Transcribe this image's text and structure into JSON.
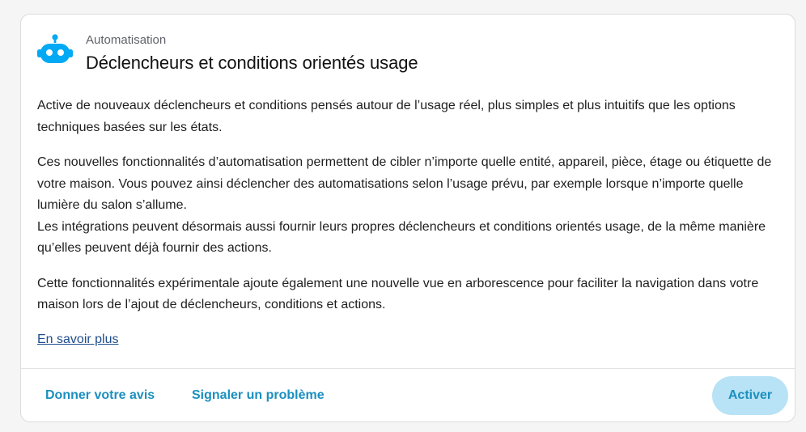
{
  "header": {
    "subtitle": "Automatisation",
    "title": "Déclencheurs et conditions orientés usage",
    "icon": "robot-icon"
  },
  "content": {
    "paragraph1": "Active de nouveaux déclencheurs et conditions pensés autour de l’usage réel, plus simples et plus intuitifs que les options techniques basées sur les états.",
    "paragraph2": "Ces nouvelles fonctionnalités d’automatisation permettent de cibler n’importe quelle entité, appareil, pièce, étage ou étiquette de votre maison. Vous pouvez ainsi déclencher des automatisations selon l’usage prévu, par exemple lorsque n’importe quelle lumière du salon s’allume.",
    "paragraph3": "Les intégrations peuvent désormais aussi fournir leurs propres déclencheurs et conditions orientés usage, de la même manière qu’elles peuvent déjà fournir des actions.",
    "paragraph4": "Cette fonctionnalités expérimentale ajoute également une nouvelle vue en arborescence pour faciliter la navigation dans votre maison lors de l’ajout de déclencheurs, conditions et actions.",
    "learn_more": "En savoir plus"
  },
  "actions": {
    "feedback_label": "Donner votre avis",
    "report_label": "Signaler un problème",
    "activate_label": "Activer"
  },
  "colors": {
    "accent": "#1b8fbf",
    "icon": "#03a9f4",
    "activate_bg": "#b8e2f5",
    "link": "#1f4e8c"
  }
}
